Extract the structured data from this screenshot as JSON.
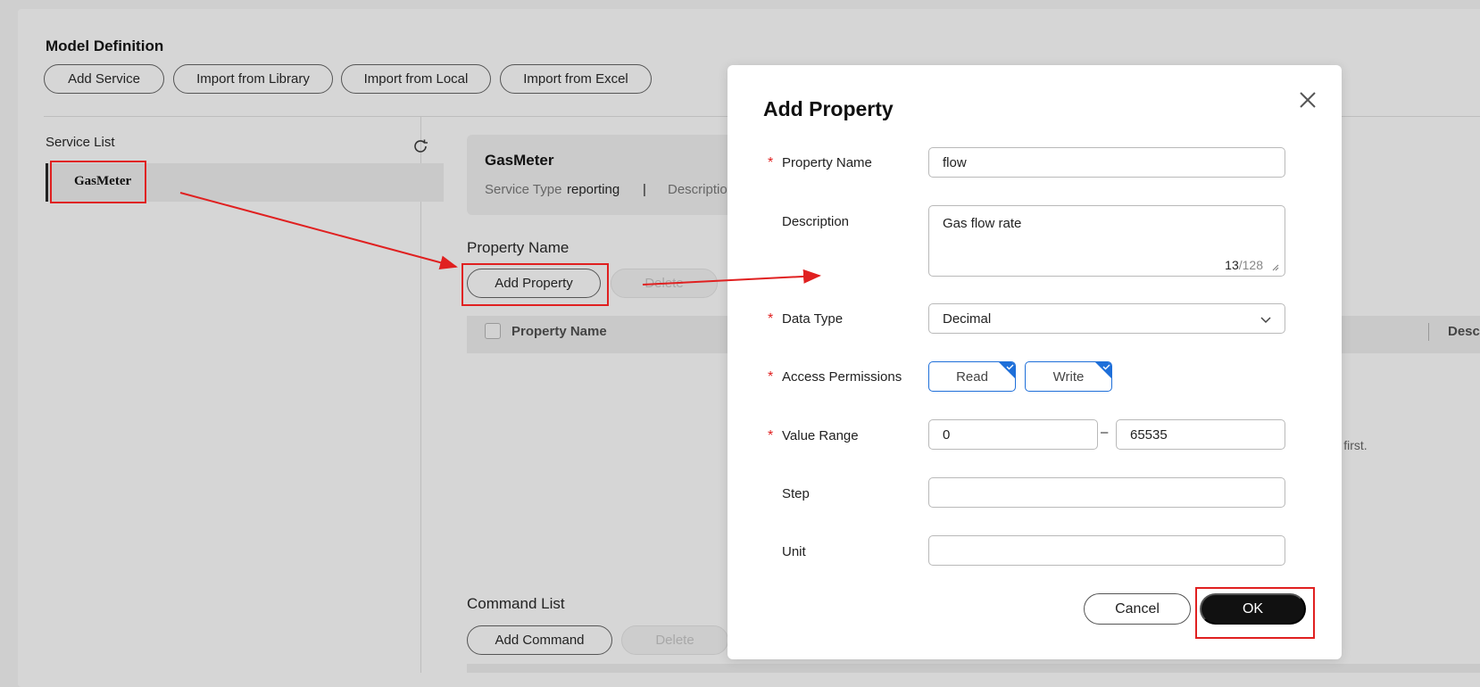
{
  "page": {
    "title": "Model Definition",
    "toolbar": {
      "add_service": "Add Service",
      "import_library": "Import from Library",
      "import_local": "Import from Local",
      "import_excel": "Import from Excel"
    },
    "service_list": {
      "label": "Service List",
      "items": [
        {
          "name": "GasMeter"
        }
      ]
    },
    "service_card": {
      "name": "GasMeter",
      "type_label": "Service Type",
      "type_value": "reporting",
      "separator": "|",
      "description_label": "Descriptio"
    },
    "property_section": {
      "title": "Property Name",
      "add_button": "Add Property",
      "delete_button": "Delete",
      "table_header": "Property Name",
      "right_header": "Descr",
      "empty_text": "erty first."
    },
    "command_section": {
      "title": "Command List",
      "add_button": "Add Command",
      "delete_button": "Delete"
    }
  },
  "modal": {
    "title": "Add Property",
    "fields": {
      "property_name": {
        "label": "Property Name",
        "value": "flow",
        "required": true
      },
      "description": {
        "label": "Description",
        "value": "Gas flow rate",
        "count": "13",
        "max": "/128"
      },
      "data_type": {
        "label": "Data Type",
        "value": "Decimal",
        "required": true
      },
      "access_permissions": {
        "label": "Access Permissions",
        "options": [
          "Read",
          "Write"
        ],
        "required": true
      },
      "value_range": {
        "label": "Value Range",
        "min": "0",
        "separator": "–",
        "max": "65535",
        "required": true
      },
      "step": {
        "label": "Step",
        "value": ""
      },
      "unit": {
        "label": "Unit",
        "value": ""
      }
    },
    "required_mark": "*",
    "cancel": "Cancel",
    "ok": "OK"
  },
  "colors": {
    "accent": "#1e6fd9",
    "annotation": "#e02020",
    "primary_button": "#111111"
  }
}
